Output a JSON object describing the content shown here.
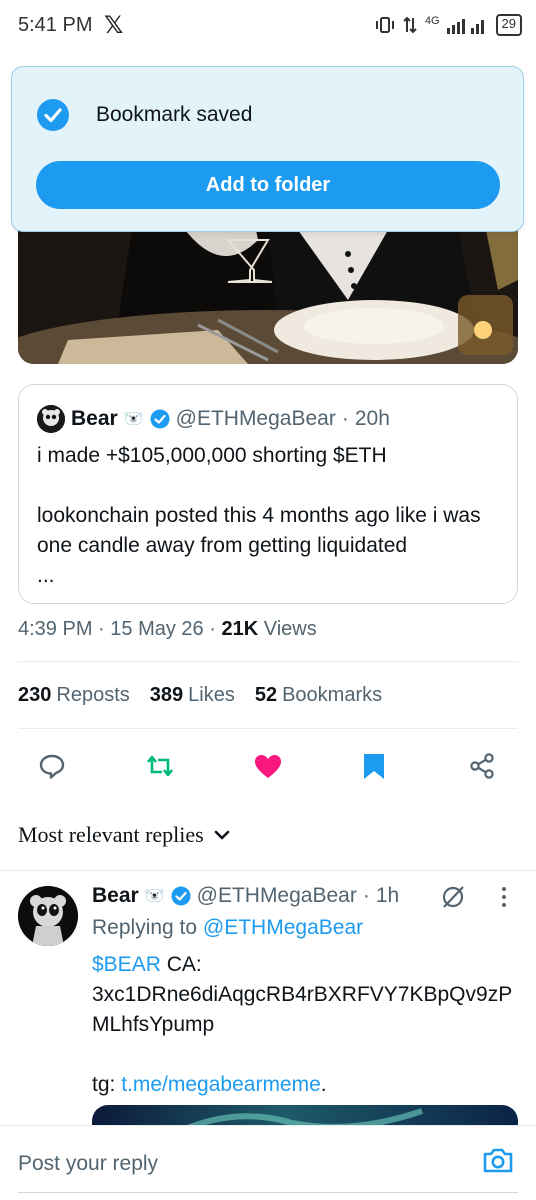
{
  "status_bar": {
    "time": "5:41 PM",
    "app_glyph": "𝕏",
    "network": "4G",
    "battery": "29"
  },
  "toast": {
    "message": "Bookmark saved",
    "button_label": "Add to folder"
  },
  "quoted_post": {
    "author_name": "Bear",
    "author_emoji": "🐻‍❄️",
    "handle": "@ETHMegaBear",
    "separator": "·",
    "time": "20h",
    "line1": "i made +$105,000,000 shorting $ETH",
    "line2": "lookonchain posted this 4 months ago like i was one candle away from getting liquidated",
    "ellipsis": "..."
  },
  "meta": {
    "time": "4:39 PM",
    "date": "15 May 26",
    "separator": "·",
    "views_count": "21K",
    "views_label": "Views"
  },
  "stats": {
    "reposts_count": "230",
    "reposts_label": "Reposts",
    "likes_count": "389",
    "likes_label": "Likes",
    "bookmarks_count": "52",
    "bookmarks_label": "Bookmarks"
  },
  "replies_sort": {
    "label": "Most relevant replies"
  },
  "reply": {
    "author_name": "Bear",
    "author_emoji": "🐻‍❄️",
    "handle": "@ETHMegaBear",
    "separator": "·",
    "time": "1h",
    "replying_prefix": "Replying to",
    "replying_handle": "@ETHMegaBear",
    "cashtag": "$BEAR",
    "ca_label": "CA:",
    "contract": "3xc1DRne6diAqgcRB4rBXRFVY7KBpQv9zPMLhfsYpump",
    "tg_label": "tg:",
    "tg_link": "t.me/megabearmeme",
    "tg_end": "."
  },
  "composer": {
    "placeholder": "Post your reply"
  },
  "colors": {
    "accent": "#1d9bf0",
    "like": "#f91880",
    "repost": "#00ba7c",
    "toast_bg": "#e3f3fa"
  },
  "icons": {
    "reply": "reply-icon",
    "repost": "repost-icon",
    "like": "heart-icon",
    "bookmark": "bookmark-icon",
    "share": "share-icon",
    "verified": "verified-icon",
    "camera": "camera-icon"
  }
}
